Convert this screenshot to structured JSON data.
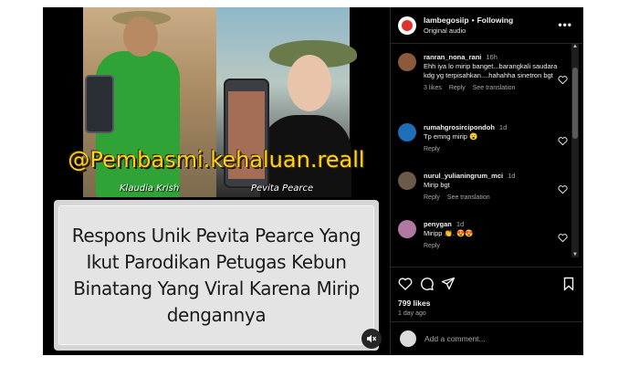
{
  "media": {
    "watermark": "@Pembasmi.kehaluan.reall",
    "name_left": "Klaudia Krish",
    "name_right": "Pevita Pearce",
    "caption": "Respons Unik Pevita Pearce Yang Ikut Parodikan Petugas Kebun Binatang Yang Viral Karena Mirip dengannya",
    "mute_icon": "speaker-muted-icon"
  },
  "header": {
    "username": "lambegosiip",
    "separator": "•",
    "follow_status": "Following",
    "audio": "Original audio",
    "more_icon": "•••"
  },
  "comments": [
    {
      "user": "ranran_nona_rani",
      "time": "16h",
      "text": "Ehh iya lo mirip banget...barangkali saudara kdg yg terpisahkan....hahahha sinetron bgt",
      "likes": "3 likes",
      "reply": "Reply",
      "translate": "See translation",
      "avatar_color": "#8a5a3c"
    },
    {
      "user": "rumahgrosircipondoh",
      "time": "1d",
      "text": "Tp emng mirip 😮",
      "likes": "",
      "reply": "Reply",
      "translate": "",
      "avatar_color": "#1e6fb8"
    },
    {
      "user": "nurul_yulianingrum_mci",
      "time": "1d",
      "text": "Mirip bgt",
      "likes": "",
      "reply": "Reply",
      "translate": "See translation",
      "avatar_color": "#6b5a4a"
    },
    {
      "user": "penygan",
      "time": "1d",
      "text": "Miripp 👏. 😍😍",
      "likes": "",
      "reply": "Reply",
      "translate": "",
      "avatar_color": "#b07aa0"
    }
  ],
  "actions": {
    "likes": "799 likes",
    "date": "1 day ago"
  },
  "add_comment": {
    "placeholder": "Add a comment..."
  },
  "colors": {
    "background": "#000000",
    "watermark": "#ffd21f",
    "muted_text": "#a8a8a8"
  }
}
